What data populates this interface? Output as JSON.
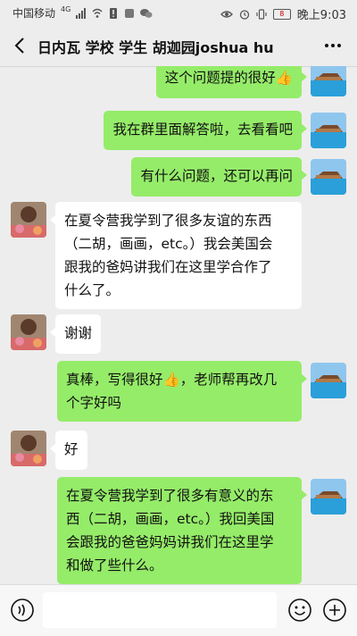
{
  "status": {
    "carrier": "中国移动",
    "network": "4G",
    "battery": "8",
    "time": "晚上9:03"
  },
  "header": {
    "title": "日内瓦 学校 学生 胡迦园joshua hu"
  },
  "messages": [
    {
      "from": "me",
      "text": "这个问题提的很好👍"
    },
    {
      "from": "me",
      "text": "我在群里面解答啦，去看看吧"
    },
    {
      "from": "me",
      "text": "有什么问题，还可以再问"
    },
    {
      "from": "them",
      "lines": [
        "在夏令营我学到了很多友谊的东西",
        "（二胡，画画，etc。）我会美国会",
        "跟我的爸妈讲我们在这里学合作了",
        "什么了。"
      ]
    },
    {
      "from": "them",
      "text": "谢谢"
    },
    {
      "from": "me",
      "lines": [
        "真棒，写得很好👍，老师帮再改几",
        "个字好吗"
      ]
    },
    {
      "from": "them",
      "text": "好"
    },
    {
      "from": "me",
      "lines": [
        "在夏令营我学到了很多有意义的东",
        "西（二胡，画画，etc。）我回美国",
        "会跟我的爸爸妈妈讲我们在这里学",
        "和做了些什么。"
      ]
    }
  ],
  "input": {
    "value": ""
  }
}
